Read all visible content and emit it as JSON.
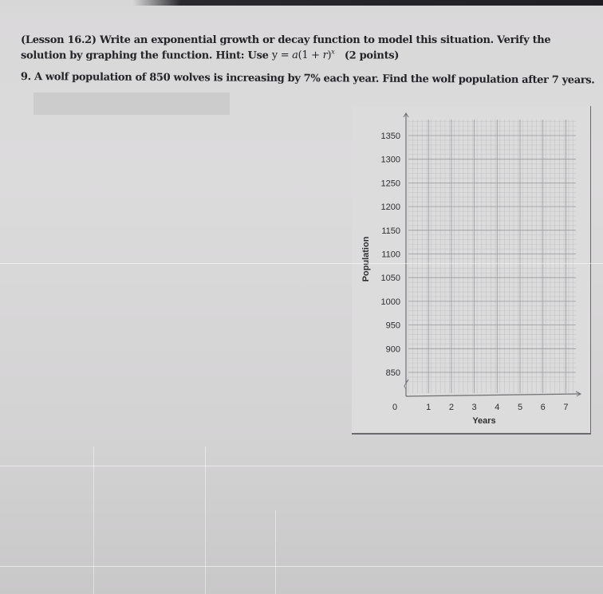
{
  "worksheet": {
    "instructions": {
      "lesson": "(Lesson 16.2)",
      "text": "Write an exponential growth or decay function to model this situation. Verify the solution by graphing the function. Hint: Use",
      "formula_prefix": "y = ",
      "formula_a": "a",
      "formula_body": "(1 + ",
      "formula_r": "r",
      "formula_close": ")",
      "formula_exp": "x",
      "points": "(2 points)"
    },
    "question": {
      "number": "9.",
      "text": "A wolf population of 850 wolves is increasing by 7% each year. Find the wolf population after 7 years."
    },
    "answer_field": {
      "value": ""
    }
  },
  "chart_data": {
    "type": "line",
    "title": "",
    "xlabel": "Years",
    "ylabel": "Population",
    "x_ticks": [
      "0",
      "1",
      "2",
      "3",
      "4",
      "5",
      "6",
      "7"
    ],
    "y_ticks": [
      "850",
      "900",
      "950",
      "1000",
      "1050",
      "1100",
      "1150",
      "1200",
      "1250",
      "1300",
      "1350"
    ],
    "xlim": [
      0,
      7
    ],
    "ylim": [
      850,
      1350
    ],
    "y_axis_break": true,
    "grid": true,
    "series": []
  },
  "colors": {
    "text": "#232328",
    "grid_major": "#9a9a9e",
    "grid_minor": "#c4c4c7",
    "axis": "#6e6e72"
  }
}
